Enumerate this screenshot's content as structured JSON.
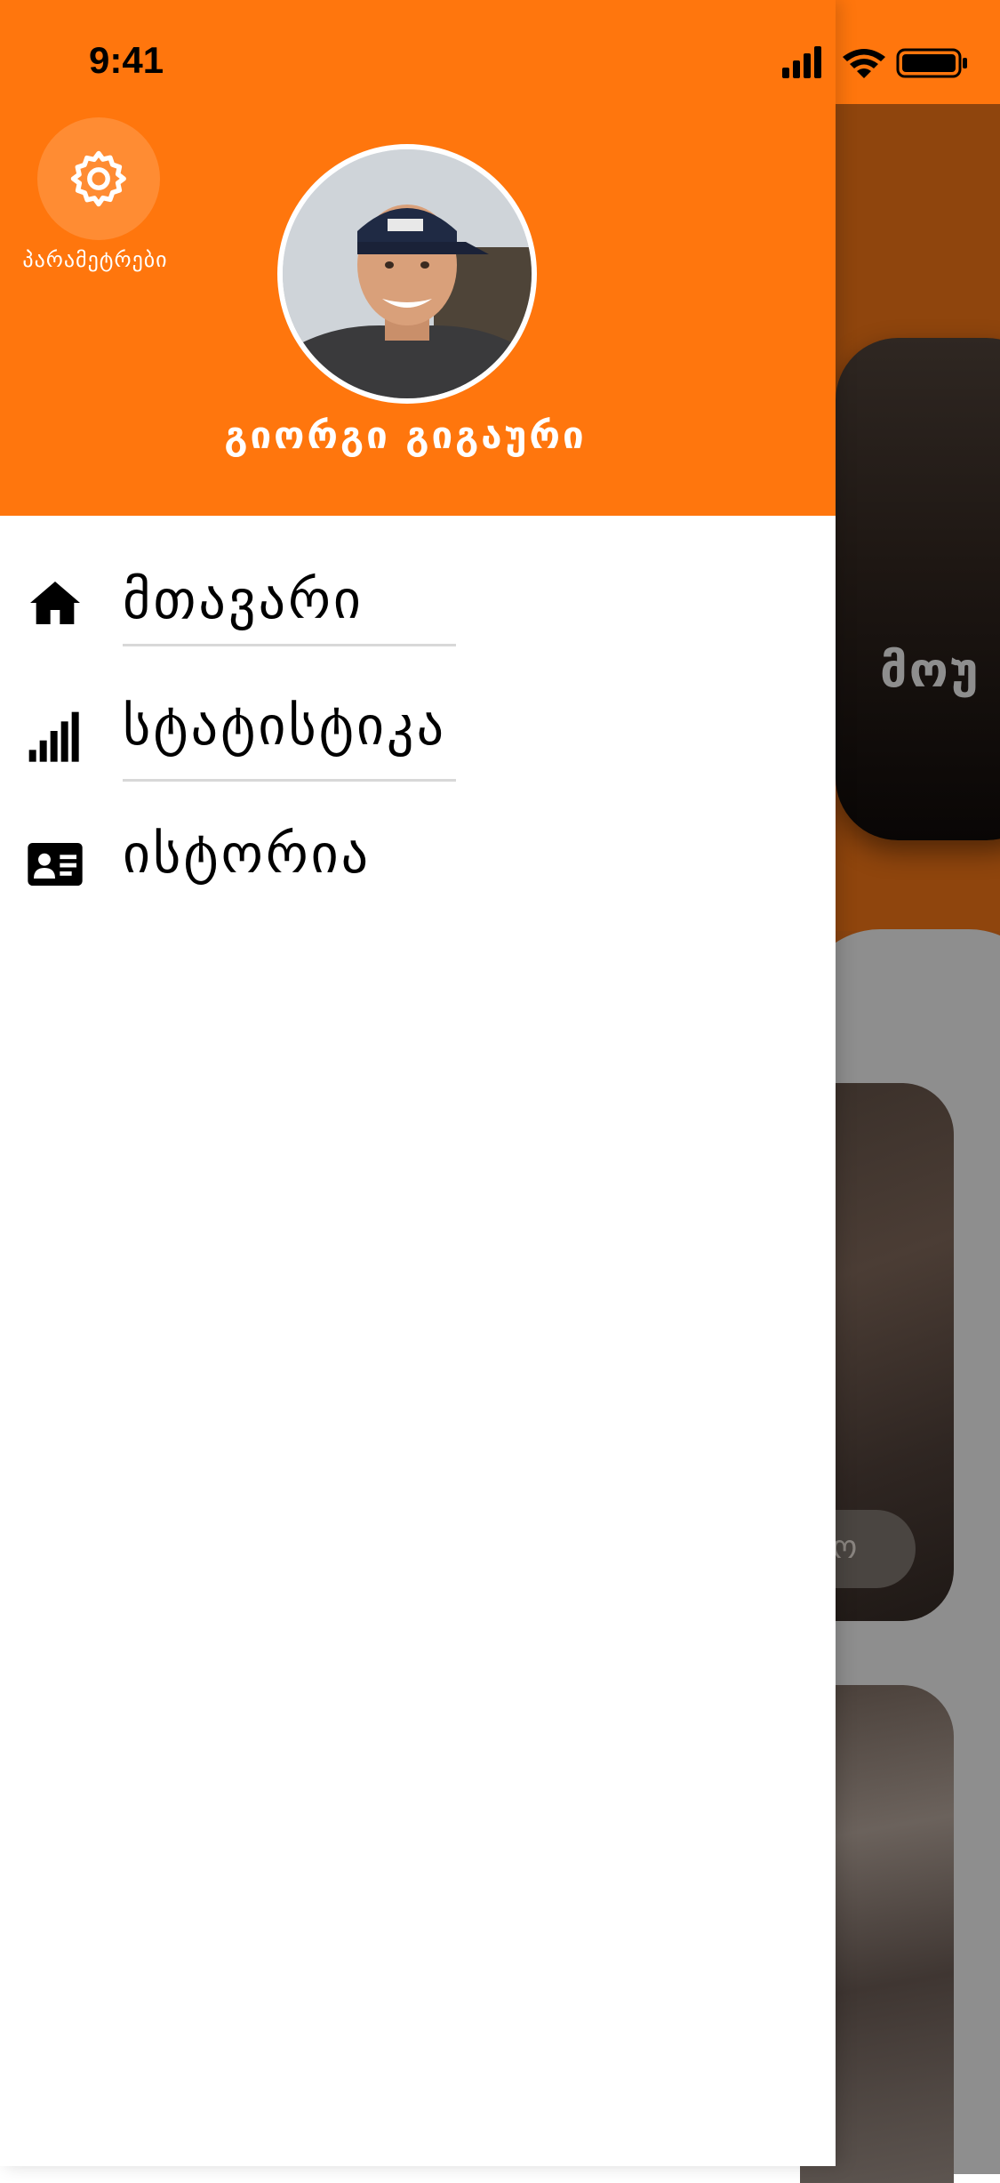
{
  "status_bar": {
    "time": "9:41"
  },
  "drawer": {
    "header": {
      "settings_label": "პარამეტრები",
      "user_name": "გიორგი გიგაური"
    },
    "menu": [
      {
        "label": "მთავარი",
        "icon": "home-icon"
      },
      {
        "label": "სტატისტიკა",
        "icon": "signal-bars-icon"
      },
      {
        "label": "ისტორია",
        "icon": "id-card-icon"
      }
    ]
  },
  "background_app": {
    "hero_text": "მოუ",
    "card_button_text": "ო"
  },
  "colors": {
    "accent": "#ff760d",
    "drawer_bg": "#ffffff",
    "divider": "#d8d8d8",
    "overlay": "#8e8e8e"
  }
}
